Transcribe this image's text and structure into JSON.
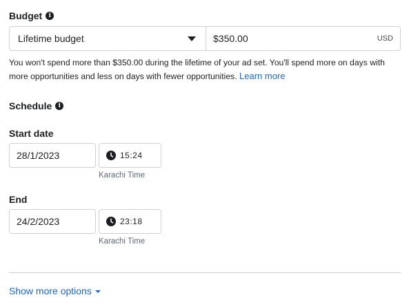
{
  "budget": {
    "label": "Budget",
    "info_icon": "info-icon",
    "type_selected": "Lifetime budget",
    "amount": "$350.00",
    "currency": "USD",
    "help_text": "You won't spend more than $350.00 during the lifetime of your ad set. You'll spend more on days with more opportunities and less on days with fewer opportunities.",
    "learn_more": "Learn more"
  },
  "schedule": {
    "label": "Schedule",
    "info_icon": "info-icon",
    "start": {
      "label": "Start date",
      "date": "28/1/2023",
      "time": "15:24",
      "timezone": "Karachi Time"
    },
    "end": {
      "label": "End",
      "date": "24/2/2023",
      "time": "23:18",
      "timezone": "Karachi Time"
    }
  },
  "show_more": "Show more options",
  "colors": {
    "link": "#1b66c9",
    "text": "#1c1e21",
    "border": "#ccd0d5",
    "muted": "#606770"
  }
}
